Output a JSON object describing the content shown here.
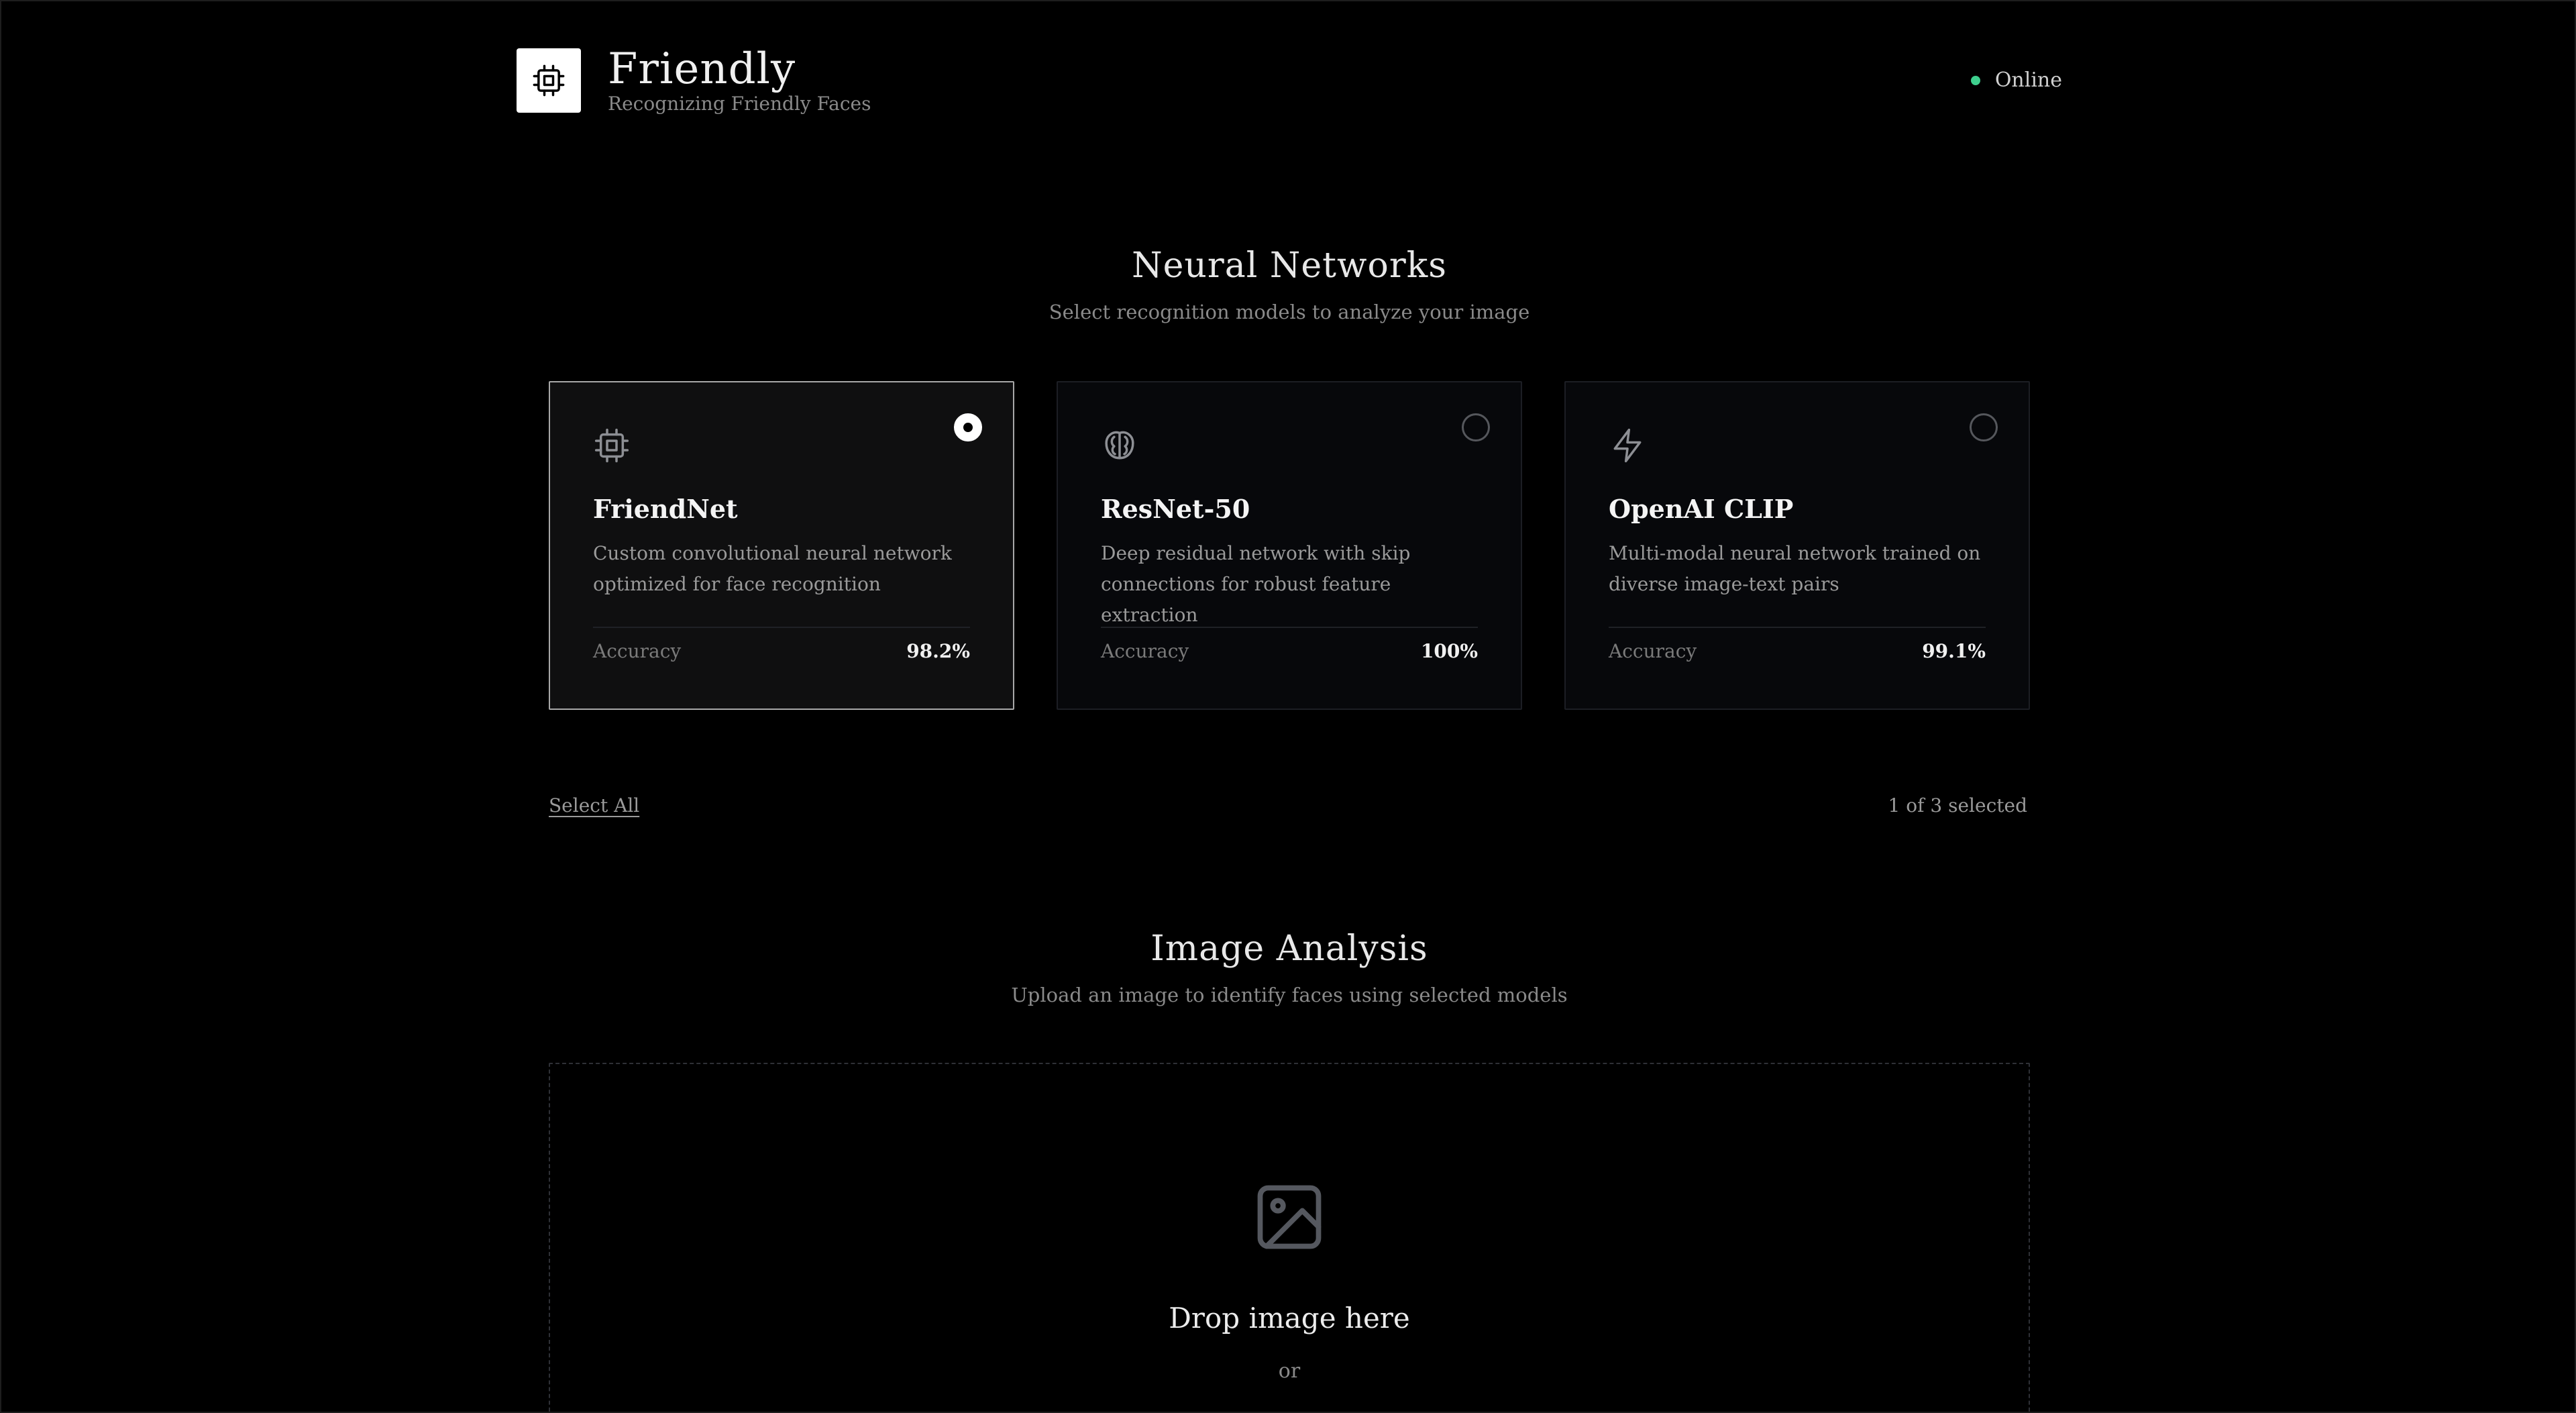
{
  "header": {
    "brand_title": "Friendly",
    "brand_subtitle": "Recognizing Friendly Faces",
    "status_label": "Online",
    "status_color": "#3ecf8e"
  },
  "models_section": {
    "title": "Neural Networks",
    "subtitle": "Select recognition models to analyze your image",
    "select_all_label": "Select All",
    "selected_count_text": "1 of 3 selected",
    "cards": [
      {
        "name": "FriendNet",
        "icon": "cpu-chip-icon",
        "description": "Custom convolutional neural network optimized for face recognition",
        "accuracy_label": "Accuracy",
        "accuracy_value": "98.2%",
        "selected": true
      },
      {
        "name": "ResNet-50",
        "icon": "brain-icon",
        "description": "Deep residual network with skip connections for robust feature extraction",
        "accuracy_label": "Accuracy",
        "accuracy_value": "100%",
        "selected": false
      },
      {
        "name": "OpenAI CLIP",
        "icon": "lightning-bolt-icon",
        "description": "Multi-modal neural network trained on diverse image-text pairs",
        "accuracy_label": "Accuracy",
        "accuracy_value": "99.1%",
        "selected": false
      }
    ]
  },
  "analysis_section": {
    "title": "Image Analysis",
    "subtitle": "Upload an image to identify faces using selected models",
    "dropzone_icon": "image-icon",
    "dropzone_title": "Drop image here",
    "dropzone_or": "or"
  }
}
